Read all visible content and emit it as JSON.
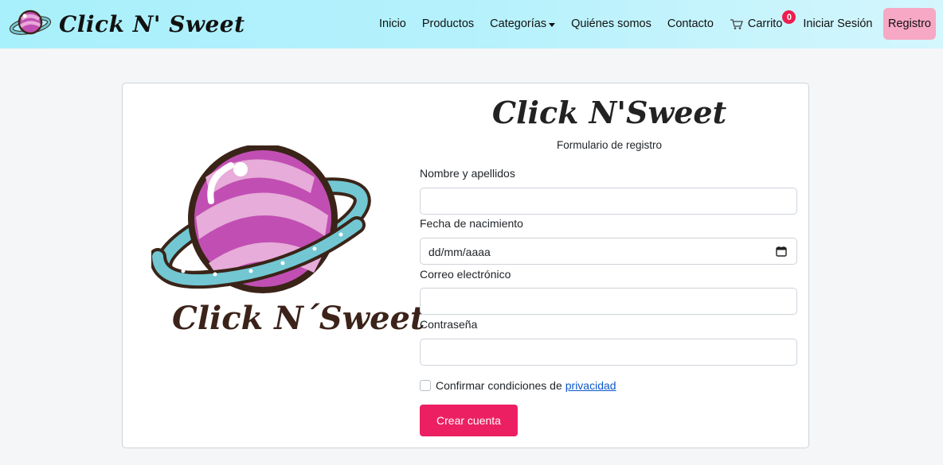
{
  "navbar": {
    "brand_name": "Click N' Sweet",
    "links": {
      "inicio": "Inicio",
      "productos": "Productos",
      "categorias": "Categorías",
      "quienes": "Quiénes somos",
      "contacto": "Contacto",
      "carrito": "Carrito",
      "login": "Iniciar Sesión",
      "registro": "Registro"
    },
    "cart_count": "0",
    "colors": {
      "registro_bg": "#f7a8c4",
      "badge": "#ef1d4f",
      "nav_bg": "#aef1fb"
    }
  },
  "card": {
    "logo_text": "Click N´Sweet",
    "title": "Click N'Sweet",
    "subtitle": "Formulario de registro",
    "fields": {
      "name_label": "Nombre y apellidos",
      "birth_label": "Fecha de nacimiento",
      "birth_placeholder": "dd/mm/aaaa",
      "email_label": "Correo electrónico",
      "password_label": "Contraseña"
    },
    "privacy_text": "Confirmar condiciones de",
    "privacy_link": "privacidad",
    "submit_label": "Crear cuenta",
    "colors": {
      "submit_bg": "#ec1f63",
      "link": "#0a58ca"
    }
  }
}
